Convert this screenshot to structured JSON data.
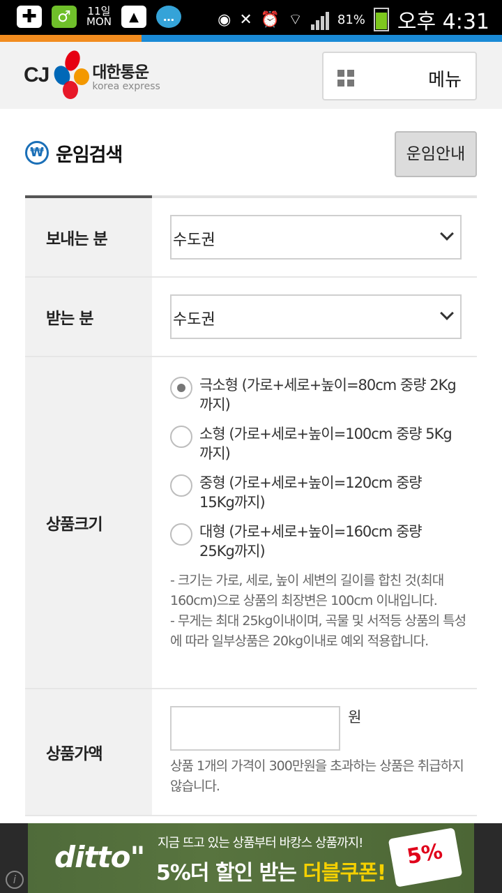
{
  "status_bar": {
    "date_day": "11일",
    "date_weekday": "MON",
    "battery_percent": "81%",
    "time": "오후 4:31",
    "battery_level": 0.81
  },
  "header": {
    "logo_cj": "CJ",
    "logo_ko": "대한통운",
    "logo_en": "korea express",
    "menu_label": "메뉴"
  },
  "page": {
    "title": "운임검색",
    "won_symbol": "₩",
    "guide_button": "운임안내"
  },
  "form": {
    "sender": {
      "label": "보내는 분",
      "value": "수도권"
    },
    "receiver": {
      "label": "받는 분",
      "value": "수도권"
    },
    "size": {
      "label": "상품크기",
      "options": [
        {
          "text": "극소형 (가로+세로+높이=80cm 중량 2Kg까지)",
          "checked": true
        },
        {
          "text": "소형 (가로+세로+높이=100cm 중량 5Kg까지)",
          "checked": false
        },
        {
          "text": "중형 (가로+세로+높이=120cm 중량 15Kg까지)",
          "checked": false
        },
        {
          "text": "대형 (가로+세로+높이=160cm 중량 25Kg까지)",
          "checked": false
        }
      ],
      "note1": "- 크기는 가로, 세로, 높이 세변의 길이를 합친 것(최대 160cm)으로 상품의 최장변은 100cm 이내입니다.",
      "note2": "- 무게는 최대 25kg이내이며, 곡물 및 서적등 상품의 특성에 따라 일부상품은 20kg이내로 예외 적용합니다."
    },
    "price": {
      "label": "상품가액",
      "value": "",
      "unit": "원",
      "note": "상품 1개의 가격이 300만원을 초과하는 상품은 취급하지 않습니다."
    }
  },
  "ad": {
    "logo": "ditto\"",
    "line1": "지금 뜨고 있는 상품부터 바캉스 상품까지!",
    "line2_white": "5%더 할인 받는",
    "line2_yellow": "더블쿠폰!",
    "coupon": "5%",
    "info": "i"
  }
}
